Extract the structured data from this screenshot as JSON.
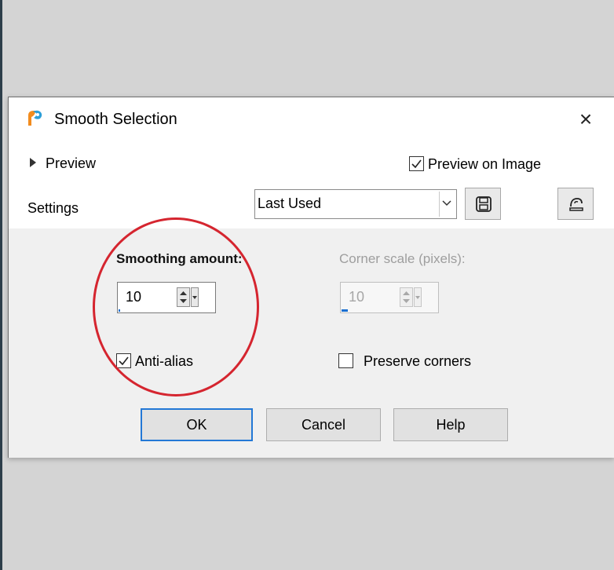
{
  "dialog": {
    "title": "Smooth Selection",
    "close_glyph": "×"
  },
  "preview": {
    "toggle_label": "Preview",
    "on_image_label": "Preview on Image",
    "on_image_checked": true
  },
  "settings": {
    "label": "Settings",
    "preset_value": "Last Used",
    "save_icon": "floppy-disk-icon",
    "reset_icon": "reset-defaults-icon"
  },
  "controls": {
    "smoothing_label": "Smoothing amount:",
    "smoothing_value": "10",
    "smoothing_level": 0.02,
    "corner_label": "Corner scale (pixels):",
    "corner_value": "10",
    "corner_level": 0.08,
    "antialias_label": "Anti-alias",
    "antialias_checked": true,
    "preserve_label": "Preserve corners",
    "preserve_checked": false
  },
  "buttons": {
    "ok": "OK",
    "cancel": "Cancel",
    "help": "Help"
  },
  "colors": {
    "accent": "#2378d6",
    "annotation": "#d5252f"
  }
}
